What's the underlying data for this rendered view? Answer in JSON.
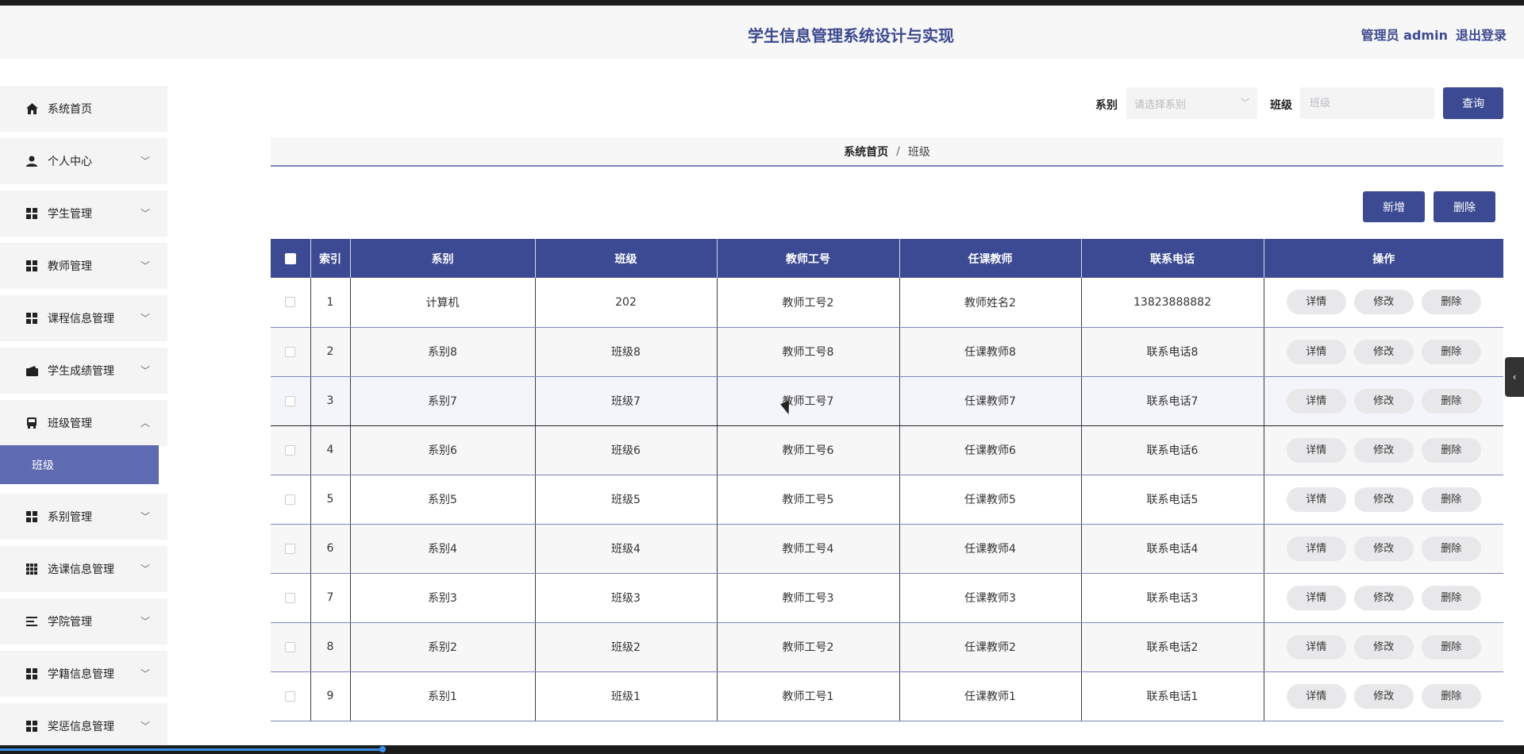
{
  "header": {
    "title": "学生信息管理系统设计与实现",
    "admin_label": "管理员 admin",
    "logout_label": "退出登录"
  },
  "sidebar": {
    "items": [
      {
        "label": "系统首页",
        "icon": "home-icon"
      },
      {
        "label": "个人中心",
        "icon": "user-icon"
      },
      {
        "label": "学生管理",
        "icon": "grid-icon"
      },
      {
        "label": "教师管理",
        "icon": "grid-icon"
      },
      {
        "label": "课程信息管理",
        "icon": "grid-icon"
      },
      {
        "label": "学生成绩管理",
        "icon": "wallet-icon"
      },
      {
        "label": "班级管理",
        "icon": "bus-icon"
      },
      {
        "label": "系别管理",
        "icon": "grid-icon"
      },
      {
        "label": "选课信息管理",
        "icon": "grid9-icon"
      },
      {
        "label": "学院管理",
        "icon": "list-icon"
      },
      {
        "label": "学籍信息管理",
        "icon": "grid-icon"
      },
      {
        "label": "奖惩信息管理",
        "icon": "grid-icon"
      }
    ],
    "active_sub_item": "班级"
  },
  "filters": {
    "dept_label": "系别",
    "dept_placeholder": "请选择系别",
    "class_label": "班级",
    "class_placeholder": "班级",
    "search_label": "查询"
  },
  "breadcrumb": {
    "home": "系统首页",
    "separator": "/",
    "current": "班级"
  },
  "toolbar": {
    "add_label": "新增",
    "delete_label": "删除"
  },
  "table": {
    "columns": [
      "索引",
      "系别",
      "班级",
      "教师工号",
      "任课教师",
      "联系电话",
      "操作"
    ],
    "rows": [
      [
        "1",
        "计算机",
        "202",
        "教师工号2",
        "教师姓名2",
        "13823888882"
      ],
      [
        "2",
        "系别8",
        "班级8",
        "教师工号8",
        "任课教师8",
        "联系电话8"
      ],
      [
        "3",
        "系别7",
        "班级7",
        "教师工号7",
        "任课教师7",
        "联系电话7"
      ],
      [
        "4",
        "系别6",
        "班级6",
        "教师工号6",
        "任课教师6",
        "联系电话6"
      ],
      [
        "5",
        "系别5",
        "班级5",
        "教师工号5",
        "任课教师5",
        "联系电话5"
      ],
      [
        "6",
        "系别4",
        "班级4",
        "教师工号4",
        "任课教师4",
        "联系电话4"
      ],
      [
        "7",
        "系别3",
        "班级3",
        "教师工号3",
        "任课教师3",
        "联系电话3"
      ],
      [
        "8",
        "系别2",
        "班级2",
        "教师工号2",
        "任课教师2",
        "联系电话2"
      ],
      [
        "9",
        "系别1",
        "班级1",
        "教师工号1",
        "任课教师1",
        "联系电话1"
      ]
    ],
    "actions": [
      "详情",
      "修改",
      "删除"
    ]
  },
  "colors": {
    "primary": "#3c4a94",
    "active_sub": "#5e6ab1",
    "sidebar_bg": "#f4f4f5"
  }
}
